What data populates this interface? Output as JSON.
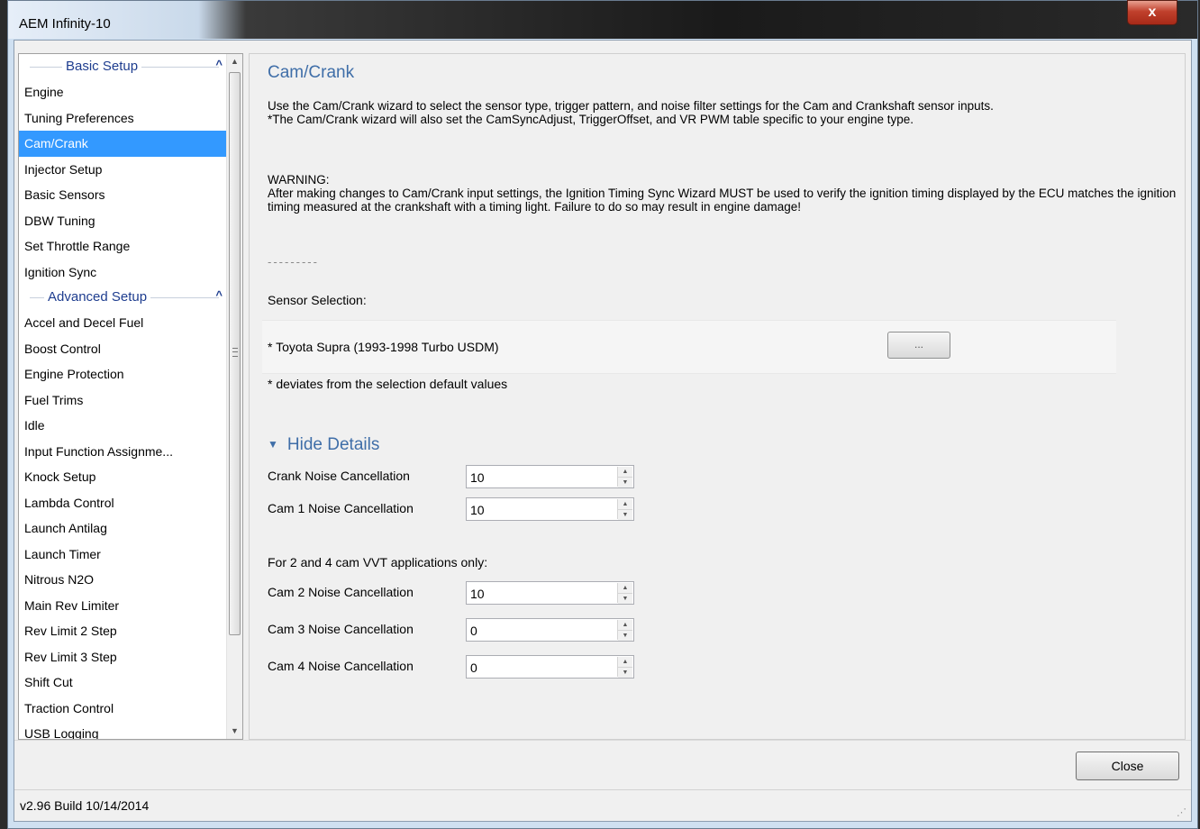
{
  "window": {
    "title": "AEM Infinity-10",
    "close_glyph": "x"
  },
  "sidebar": {
    "groups": [
      {
        "label": "Basic Setup",
        "chevron": "^"
      },
      {
        "label": "Advanced Setup",
        "chevron": "^"
      }
    ],
    "basic_items": [
      "Engine",
      "Tuning Preferences",
      "Cam/Crank",
      "Injector Setup",
      "Basic Sensors",
      "DBW Tuning",
      "Set Throttle Range",
      "Ignition Sync"
    ],
    "advanced_items": [
      "Accel and Decel Fuel",
      "Boost Control",
      "Engine Protection",
      "Fuel Trims",
      "Idle",
      "Input Function Assignme...",
      "Knock Setup",
      "Lambda Control",
      "Launch Antilag",
      "Launch Timer",
      "Nitrous N2O",
      "Main Rev Limiter",
      "Rev Limit 2 Step",
      "Rev Limit 3 Step",
      "Shift Cut",
      "Traction Control",
      "USB Logging"
    ],
    "selected": "Cam/Crank"
  },
  "main": {
    "title": "Cam/Crank",
    "description_1": "Use the Cam/Crank wizard to select the sensor type, trigger pattern, and noise filter settings for the Cam and Crankshaft sensor inputs.",
    "description_2": "*The Cam/Crank wizard will also set the CamSyncAdjust, TriggerOffset, and VR PWM table specific to your engine type.",
    "warning_heading": "WARNING:",
    "warning_text": "After making changes to Cam/Crank input settings, the Ignition Timing Sync Wizard MUST be used to verify the ignition timing displayed by the ECU matches the ignition timing measured at the crankshaft with a timing light. Failure to do so may result in engine damage!",
    "dashes": "---------",
    "sensor_selection_label": "Sensor Selection:",
    "sensor_selection_value": "* Toyota Supra (1993-1998 Turbo USDM)",
    "sensor_button_label": "...",
    "deviation_note": "* deviates from the selection default values",
    "toggle_details_label": "Hide Details",
    "fields": [
      {
        "label": "Crank Noise Cancellation",
        "value": "10"
      },
      {
        "label": "Cam 1 Noise Cancellation",
        "value": "10"
      },
      {
        "label": "Cam 2 Noise Cancellation",
        "value": "10"
      },
      {
        "label": "Cam 3 Noise Cancellation",
        "value": "0"
      },
      {
        "label": "Cam 4 Noise Cancellation",
        "value": "0"
      }
    ],
    "vvt_note": "For 2 and 4 cam VVT applications only:"
  },
  "footer": {
    "close_label": "Close",
    "version": "v2.96 Build 10/14/2014"
  },
  "colors": {
    "accent": "#3f6ea8",
    "selection": "#3399ff",
    "group_header": "#1e3d8f"
  }
}
